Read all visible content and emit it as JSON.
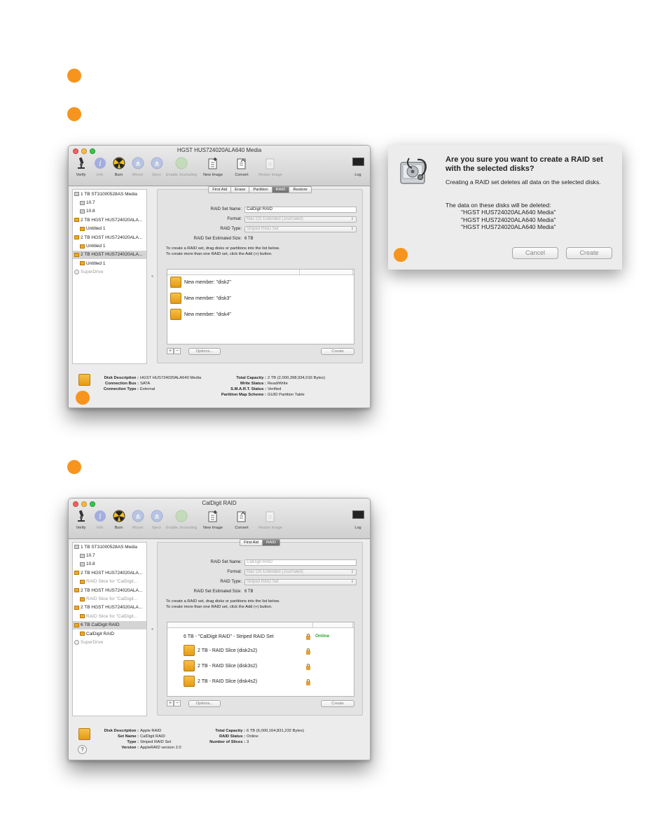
{
  "accent_color": "#f7941d",
  "toolbar": [
    {
      "label": "Verify",
      "icon": "microscope-icon",
      "dim": false
    },
    {
      "label": "Info",
      "icon": "info-icon",
      "dim": true
    },
    {
      "label": "Burn",
      "icon": "burn-icon",
      "dim": false
    },
    {
      "label": "Mount",
      "icon": "mount-icon",
      "dim": true
    },
    {
      "label": "Eject",
      "icon": "eject-icon",
      "dim": true
    },
    {
      "label": "Enable Journaling",
      "icon": "journaling-icon",
      "dim": true
    },
    {
      "label": "New Image",
      "icon": "new-image-icon",
      "dim": false
    },
    {
      "label": "Convert",
      "icon": "convert-icon",
      "dim": false
    },
    {
      "label": "Resize Image",
      "icon": "resize-image-icon",
      "dim": true
    }
  ],
  "log_label": "Log",
  "window1": {
    "title": "HGST HUS724020ALA640 Media",
    "sidebar": [
      {
        "label": "1 TB ST31000528AS Media",
        "icon": "gray",
        "indent": false,
        "sel": false,
        "dim": false
      },
      {
        "label": "10.7",
        "icon": "gray",
        "indent": true,
        "sel": false,
        "dim": false
      },
      {
        "label": "10.8",
        "icon": "gray",
        "indent": true,
        "sel": false,
        "dim": false
      },
      {
        "label": "2 TB HGST HUS724020ALA...",
        "icon": "orange",
        "indent": false,
        "sel": false,
        "dim": false
      },
      {
        "label": "Untitled 1",
        "icon": "orange",
        "indent": true,
        "sel": false,
        "dim": false
      },
      {
        "label": "2 TB HGST HUS724020ALA...",
        "icon": "orange",
        "indent": false,
        "sel": false,
        "dim": false
      },
      {
        "label": "Untitled 1",
        "icon": "orange",
        "indent": true,
        "sel": false,
        "dim": false
      },
      {
        "label": "2 TB HGST HUS724020ALA...",
        "icon": "orange",
        "indent": false,
        "sel": true,
        "dim": false
      },
      {
        "label": "Untitled 1",
        "icon": "orange",
        "indent": true,
        "sel": false,
        "dim": false
      },
      {
        "label": "SuperDrive",
        "icon": "cd",
        "indent": false,
        "sel": false,
        "dim": true
      }
    ],
    "tabs": [
      {
        "label": "First Aid",
        "active": false
      },
      {
        "label": "Erase",
        "active": false
      },
      {
        "label": "Partition",
        "active": false
      },
      {
        "label": "RAID",
        "active": true
      },
      {
        "label": "Restore",
        "active": false
      }
    ],
    "raid_name_label": "RAID Set Name:",
    "raid_name_value": "CalDigit RAID",
    "format_label": "Format:",
    "format_value": "Mac OS Extended (Journaled)",
    "raid_type_label": "RAID Type:",
    "raid_type_value": "Striped RAID Set",
    "est_size_label": "RAID Set Estimated Size:",
    "est_size_value": "6 TB",
    "instructions": [
      "To create a RAID set, drag disks or partitions into the list below.",
      "To create more than one RAID set, click the Add (+) button."
    ],
    "members": [
      "New member: \"disk2\"",
      "New member: \"disk3\"",
      "New member: \"disk4\""
    ],
    "plus": "+",
    "minus": "−",
    "options_label": "Options...",
    "create_label": "Create",
    "info_left": [
      {
        "k": "Disk Description :",
        "v": "HGST HUS724020ALA640 Media"
      },
      {
        "k": "Connection Bus :",
        "v": "SATA"
      },
      {
        "k": "Connection Type :",
        "v": "External"
      }
    ],
    "info_right": [
      {
        "k": "Total Capacity :",
        "v": "2 TB (2,000,398,934,016 Bytes)"
      },
      {
        "k": "Write Status :",
        "v": "Read/Write"
      },
      {
        "k": "S.M.A.R.T. Status :",
        "v": "Verified"
      },
      {
        "k": "Partition Map Scheme :",
        "v": "GUID Partition Table"
      }
    ]
  },
  "window2": {
    "title": "CalDigit RAID",
    "sidebar": [
      {
        "label": "1 TB ST31000528AS Media",
        "icon": "gray",
        "indent": false,
        "sel": false,
        "dim": false
      },
      {
        "label": "10.7",
        "icon": "gray",
        "indent": true,
        "sel": false,
        "dim": false
      },
      {
        "label": "10.8",
        "icon": "gray",
        "indent": true,
        "sel": false,
        "dim": false
      },
      {
        "label": "2 TB HGST HUS724020ALA...",
        "icon": "orange",
        "indent": false,
        "sel": false,
        "dim": false
      },
      {
        "label": "RAID Slice for \"CalDigit...",
        "icon": "orange",
        "indent": true,
        "sel": false,
        "dim": true
      },
      {
        "label": "2 TB HGST HUS724020ALA...",
        "icon": "orange",
        "indent": false,
        "sel": false,
        "dim": false
      },
      {
        "label": "RAID Slice for \"CalDigit...",
        "icon": "orange",
        "indent": true,
        "sel": false,
        "dim": true
      },
      {
        "label": "2 TB HGST HUS724020ALA...",
        "icon": "orange",
        "indent": false,
        "sel": false,
        "dim": false
      },
      {
        "label": "RAID Slice for \"CalDigit...",
        "icon": "orange",
        "indent": true,
        "sel": false,
        "dim": true
      },
      {
        "label": "6 TB CalDigit RAID",
        "icon": "orange",
        "indent": false,
        "sel": true,
        "dim": false
      },
      {
        "label": "CalDigit RAID",
        "icon": "orange",
        "indent": true,
        "sel": false,
        "dim": false
      },
      {
        "label": "SuperDrive",
        "icon": "cd",
        "indent": false,
        "sel": false,
        "dim": true
      }
    ],
    "tabs": [
      {
        "label": "First Aid",
        "active": false
      },
      {
        "label": "RAID",
        "active": true
      }
    ],
    "raid_name_label": "RAID Set Name:",
    "raid_name_value": "CalDigit RAID",
    "format_label": "Format:",
    "format_value": "Mac OS Extended (Journaled)",
    "raid_type_label": "RAID Type:",
    "raid_type_value": "Striped RAID Set",
    "est_size_label": "RAID Set Estimated Size:",
    "est_size_value": "6 TB",
    "instructions": [
      "To create a RAID set, drag disks or partitions into the list below.",
      "To create more than one RAID set, click the Add (+) button."
    ],
    "set_label": "6 TB - \"CalDigit RAID\" - Striped RAID Set",
    "set_status": "Online",
    "slices": [
      "2 TB - RAID Slice (disk2s2)",
      "2 TB - RAID Slice (disk3s2)",
      "2 TB - RAID Slice (disk4s2)"
    ],
    "plus": "+",
    "minus": "−",
    "options_label": "Options...",
    "create_label": "Create",
    "info_left": [
      {
        "k": "Disk Description :",
        "v": "Apple RAID"
      },
      {
        "k": "Set Name :",
        "v": "CalDigit RAID"
      },
      {
        "k": "Type :",
        "v": "Striped RAID Set"
      },
      {
        "k": "Version :",
        "v": "AppleRAID version 2.0"
      }
    ],
    "info_right": [
      {
        "k": "Total Capacity :",
        "v": "6 TB (6,000,164,831,232 Bytes)"
      },
      {
        "k": "RAID Status :",
        "v": "Online"
      },
      {
        "k": "Number of Slices :",
        "v": "3"
      }
    ],
    "help": "?"
  },
  "sheet": {
    "title": "Are you sure you want to create a RAID set with the selected disks?",
    "message": "Creating a RAID set deletes all data on the selected disks.",
    "data_intro": "The data on these disks will be deleted:",
    "disks": [
      "\"HGST HUS724020ALA640 Media\"",
      "\"HGST HUS724020ALA640 Media\"",
      "\"HGST HUS724020ALA640 Media\""
    ],
    "cancel_label": "Cancel",
    "create_label": "Create"
  }
}
